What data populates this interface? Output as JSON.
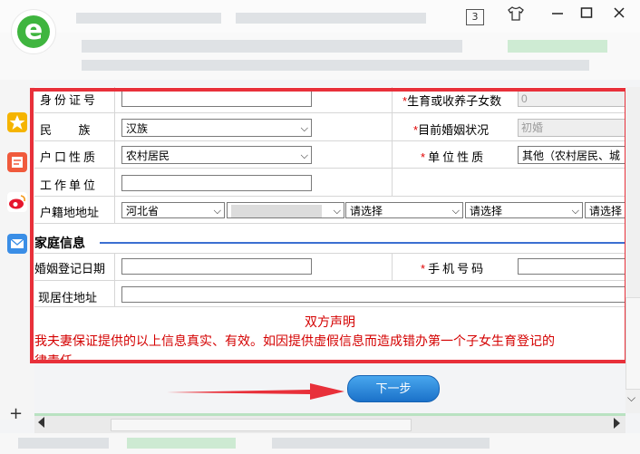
{
  "window": {
    "tab_count": "3",
    "controls": {
      "skin_icon": "shirt-icon",
      "minimize_icon": "minimize-icon",
      "maximize_icon": "maximize-icon",
      "close_icon": "close-icon"
    }
  },
  "sidebar": {
    "items": [
      {
        "icon": "star-icon",
        "color": "#f5b400"
      },
      {
        "icon": "notes-icon",
        "color": "#f05a3c"
      },
      {
        "icon": "weibo-icon",
        "color": "#e6162d"
      },
      {
        "icon": "mail-icon",
        "color": "#3a8ee6"
      }
    ],
    "add_label": "+"
  },
  "form": {
    "id_label": "身份证号",
    "id_value": "",
    "children_label": "生育或收养子女数",
    "children_value": "0",
    "ethnicity_label": "民    族",
    "ethnicity_value": "汉族",
    "marital_label": "目前婚姻状况",
    "marital_value": "初婚",
    "hukou_type_label": "户口性质",
    "hukou_type_value": "农村居民",
    "unit_type_label": "单位性质",
    "unit_type_value": "其他（农村居民、城",
    "workplace_label": "工作单位",
    "workplace_value": "",
    "hukou_addr_label": "户籍地地址",
    "province_value": "河北省",
    "city_value": "",
    "county_value": "请选择",
    "town_value": "请选择",
    "village_value": "请选择",
    "family_section": "家庭信息",
    "marriage_date_label": "婚姻登记日期",
    "marriage_date_value": "",
    "phone_label": "手机号码",
    "phone_value": "",
    "residence_label": "现居住地址",
    "residence_value": "",
    "declaration_title": "双方声明",
    "declaration_text": "我夫妻保证提供的以上信息真实、有效。如因提供虚假信息而造成错办第一个子女生育登记的",
    "declaration_text2": "律责任"
  },
  "actions": {
    "next_label": "下一步"
  },
  "colors": {
    "highlight_frame": "#e8303a",
    "annotation_arrow": "#e8303a",
    "required_star": "#e00000",
    "declaration_text": "#d40000",
    "section_line": "#3c6fd1",
    "next_button": "#2a86dc"
  }
}
